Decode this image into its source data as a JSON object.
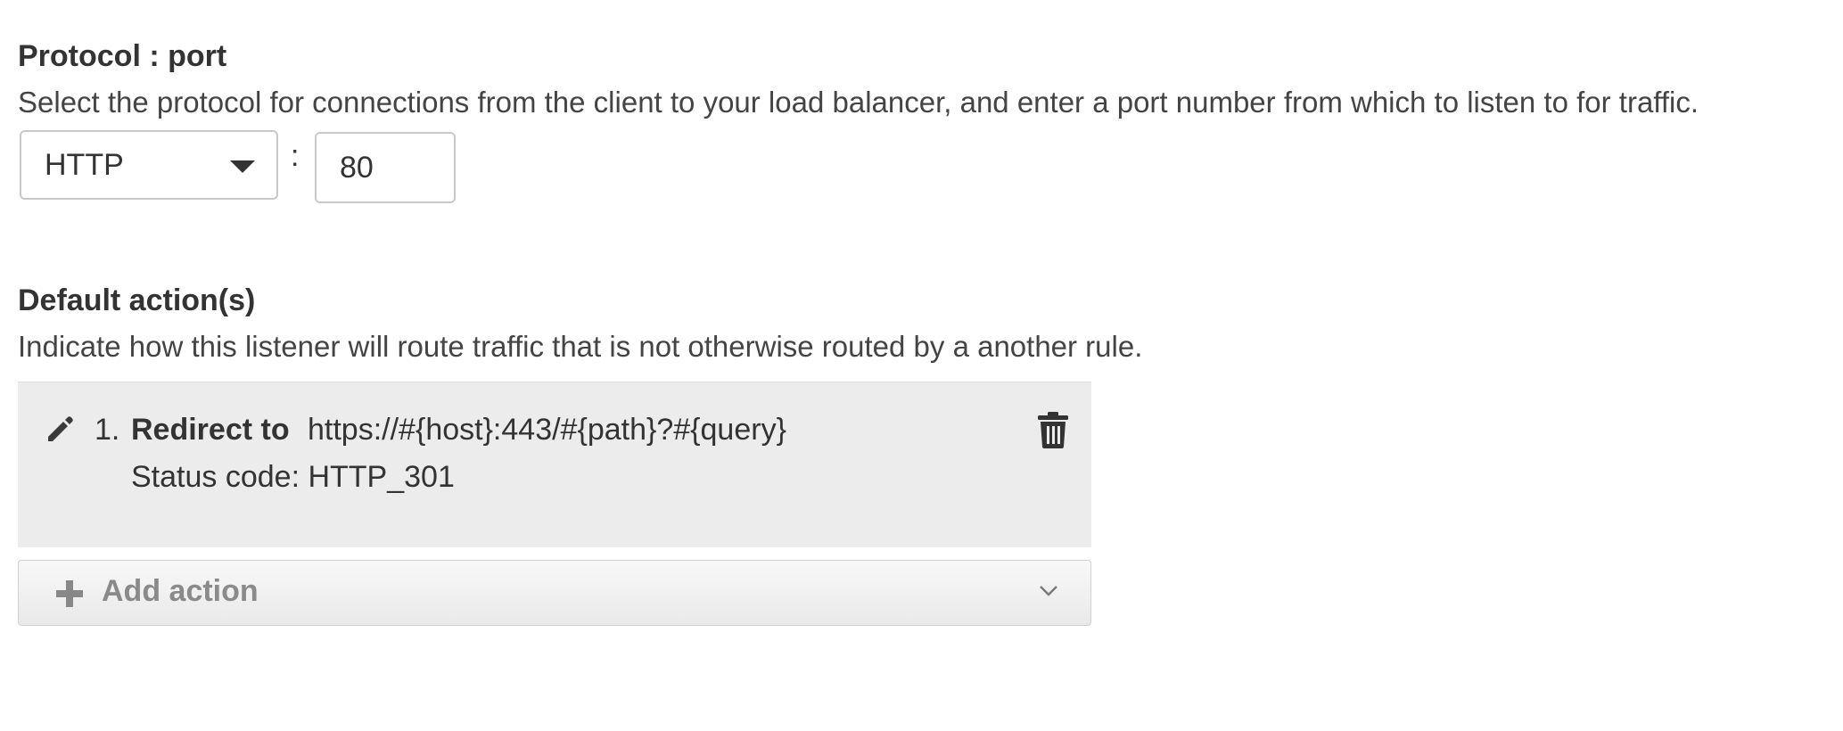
{
  "protocol": {
    "title": "Protocol : port",
    "description": "Select the protocol for connections from the client to your load balancer, and enter a port number from which to listen to for traffic.",
    "selected": "HTTP",
    "separator": ":",
    "port": "80"
  },
  "default_actions": {
    "title": "Default action(s)",
    "description": "Indicate how this listener will route traffic that is not otherwise routed by a another rule.",
    "items": [
      {
        "number": "1.",
        "type": "Redirect to",
        "url": "https://#{host}:443/#{path}?#{query}",
        "status": "Status code: HTTP_301"
      }
    ],
    "add_label": "Add action"
  },
  "icons": {
    "edit": "pencil-icon",
    "delete": "trash-icon",
    "add": "plus-icon",
    "expand": "chevron-down-icon",
    "dropdown": "caret-down-icon"
  },
  "colors": {
    "panel_bg": "#ececec",
    "text": "#333333",
    "muted": "#8a8a8a",
    "border": "#c8c8c8"
  }
}
